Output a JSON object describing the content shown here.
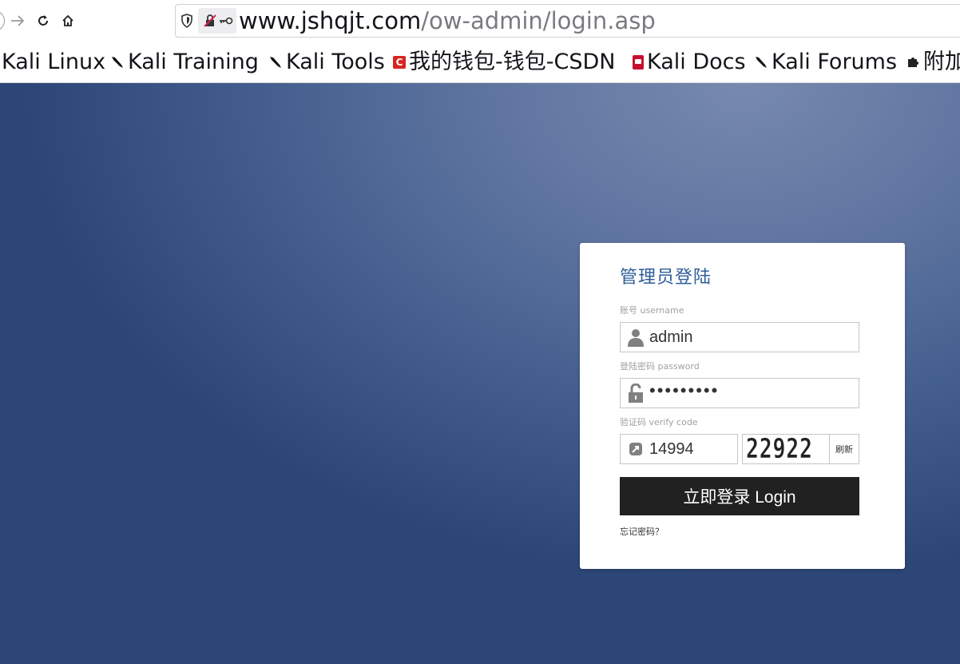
{
  "browser": {
    "url_host": "www.jshqjt.com",
    "url_path": "/ow-admin/login.asp"
  },
  "bookmarks": [
    {
      "label": "Kali Linux",
      "icon": "kali-dragon-icon"
    },
    {
      "label": "Kali Training",
      "icon": "kali-dragon-icon"
    },
    {
      "label": "Kali Tools",
      "icon": "kali-dragon-icon"
    },
    {
      "label": "我的钱包-钱包-CSDN",
      "icon": "csdn-icon"
    },
    {
      "label": "Kali Docs",
      "icon": "kali-docs-icon"
    },
    {
      "label": "Kali Forums",
      "icon": "kali-dragon-icon"
    },
    {
      "label": "附加",
      "icon": "puzzle-icon"
    }
  ],
  "login": {
    "title": "管理员登陆",
    "username_label": "账号 username",
    "username_value": "admin",
    "password_label": "登陆密码 password",
    "password_value": "•••••••••",
    "code_label": "验证码 verify code",
    "code_value": "14994",
    "captcha_text": "22922",
    "refresh_label": "刷新",
    "submit_label": "立即登录 Login",
    "forgot_label": "忘记密码？"
  },
  "colors": {
    "title": "#2e5c9a",
    "button": "#212121",
    "background_light": "#7789ae",
    "background_dark": "#2c4677"
  }
}
